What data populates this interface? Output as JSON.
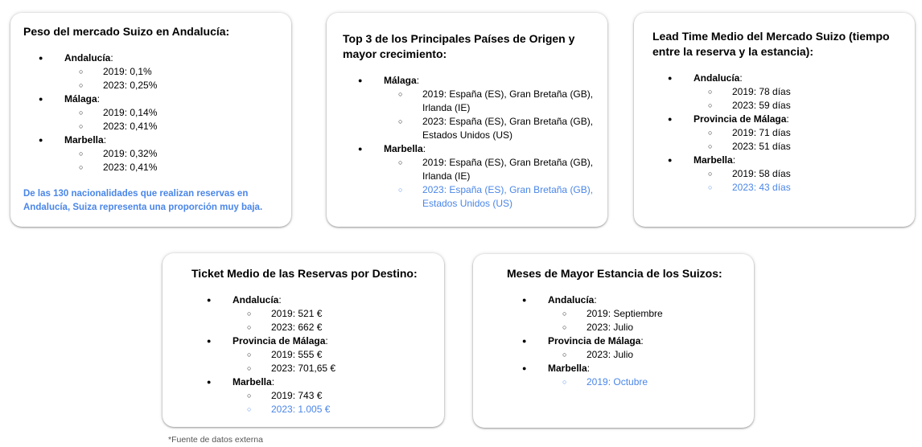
{
  "card1": {
    "title": "Peso del mercado Suizo en Andalucía:",
    "regions": [
      {
        "name": "Andalucía",
        "items": [
          "2019: 0,1%",
          "2023: 0,25%"
        ]
      },
      {
        "name": "Málaga",
        "items": [
          "2019: 0,14%",
          "2023: 0,41%"
        ]
      },
      {
        "name": "Marbella",
        "items": [
          "2019: 0,32%",
          "2023: 0,41%"
        ]
      }
    ],
    "note": "De las 130 nacionalidades que realizan reservas en Andalucía, Suiza representa una proporción muy baja."
  },
  "card2": {
    "title": "Top 3 de los Principales Países de Origen y mayor crecimiento:",
    "regions": [
      {
        "name": "Málaga",
        "items": [
          "2019: España (ES), Gran Bretaña (GB), Irlanda (IE)",
          "2023: España (ES), Gran Bretaña (GB), Estados Unidos (US)"
        ]
      },
      {
        "name": "Marbella",
        "items": [
          "2019: España (ES), Gran Bretaña (GB), Irlanda (IE)",
          "2023: España (ES), Gran Bretaña (GB), Estados Unidos (US)"
        ]
      }
    ]
  },
  "card3": {
    "title": "Lead Time Medio del Mercado Suizo (tiempo entre la reserva y la estancia):",
    "regions": [
      {
        "name": "Andalucía",
        "items": [
          "2019: 78 días",
          "2023: 59 días"
        ]
      },
      {
        "name": "Provincia de Málaga",
        "items": [
          "2019: 71 días",
          "2023: 51 días"
        ]
      },
      {
        "name": "Marbella",
        "items": [
          "2019: 58 días",
          "2023: 43 días"
        ]
      }
    ]
  },
  "card4": {
    "title": "Ticket Medio de las Reservas por Destino:",
    "regions": [
      {
        "name": "Andalucía",
        "items": [
          "2019: 521 €",
          "2023: 662 €"
        ]
      },
      {
        "name": "Provincia de Málaga",
        "items": [
          "2019: 555 €",
          "2023: 701,65 €"
        ]
      },
      {
        "name": "Marbella",
        "items": [
          "2019: 743 €",
          "2023: 1.005 €"
        ]
      }
    ]
  },
  "card5": {
    "title": "Meses de Mayor Estancia de los Suizos:",
    "regions": [
      {
        "name": "Andalucía",
        "items": [
          "2019: Septiembre",
          "2023: Julio"
        ]
      },
      {
        "name": "Provincia de Málaga",
        "items": [
          "2023: Julio"
        ]
      },
      {
        "name": "Marbella",
        "items": [
          "2019: Octubre"
        ]
      }
    ]
  },
  "footer": "*Fuente de datos externa",
  "colors": {
    "highlight": "#4a86e8",
    "card_bg": "#ffffff",
    "text": "#000000"
  }
}
